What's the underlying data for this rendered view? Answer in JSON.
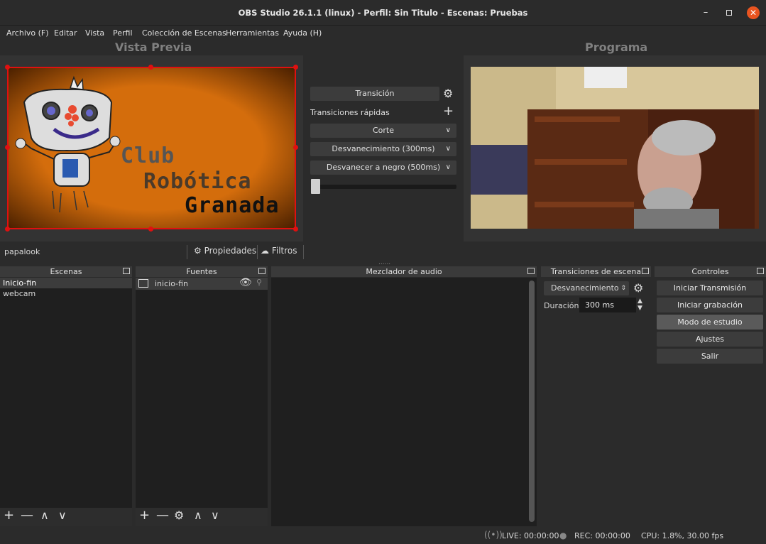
{
  "window": {
    "title": "OBS Studio 26.1.1 (linux) - Perfil: Sin Titulo - Escenas: Pruebas"
  },
  "menu": [
    "Archivo (F)",
    "Editar",
    "Vista",
    "Perfil",
    "Colección de Escenas",
    "Herramientas",
    "Ayuda (H)"
  ],
  "preview": {
    "title": "Vista Previa",
    "logo_lines": [
      "Club",
      "Robótica",
      "Granada"
    ]
  },
  "program": {
    "title": "Programa"
  },
  "transition_panel": {
    "transition_button": "Transición",
    "quick_label": "Transiciones rápidas",
    "items": [
      "Corte",
      "Desvanecimiento (300ms)",
      "Desvanecer a negro (500ms)"
    ],
    "slider_value": 0
  },
  "source_bar": {
    "selected_source": "papalook",
    "properties": "Propiedades",
    "filters": "Filtros"
  },
  "scenes": {
    "title": "Escenas",
    "items": [
      "Inicio-fin",
      "webcam"
    ]
  },
  "sources": {
    "title": "Fuentes",
    "items": [
      "inicio-fin"
    ]
  },
  "mixer": {
    "title": "Mezclador de audio"
  },
  "scene_transitions": {
    "title": "Transiciones de escena",
    "selected": "Desvanecimiento",
    "duration_label": "Duración",
    "duration_value": "300 ms"
  },
  "controls": {
    "title": "Controles",
    "buttons": [
      "Iniciar Transmisión",
      "Iniciar grabación",
      "Modo de estudio",
      "Ajustes",
      "Salir"
    ]
  },
  "status": {
    "live": "LIVE: 00:00:00",
    "rec": "REC: 00:00:00",
    "cpu": "CPU: 1.8%, 30.00 fps"
  },
  "colors": {
    "accent_red": "#e01010",
    "close_button": "#e95420",
    "preview_bg": "#c56408"
  }
}
